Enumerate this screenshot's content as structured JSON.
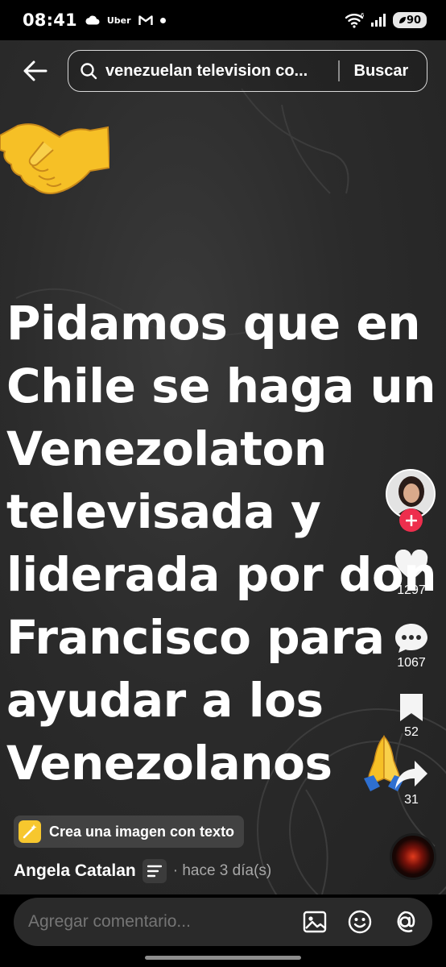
{
  "status_bar": {
    "time": "08:41",
    "uber_label": "Uber",
    "network_label": "6",
    "battery": "90"
  },
  "search": {
    "query": "venezuelan television co...",
    "button_label": "Buscar"
  },
  "post": {
    "caption": "Pidamos que en\nChile se haga un\nVenezolaton\ntelevisada y\nliderada por don\nFrancisco para\nayudar a los\nVenezolanos",
    "likes": "1297",
    "comments": "1067",
    "saves": "52",
    "shares": "31",
    "create_chip_label": "Crea una imagen con texto",
    "author": "Angela Catalan",
    "time_ago": "· hace 3 día(s)"
  },
  "comment_bar": {
    "placeholder": "Agregar comentario..."
  },
  "colors": {
    "follow": "#ee2e4d",
    "chip_icon": "#f7c72e",
    "emoji": "#f6c026"
  },
  "icons": [
    "cloud-icon",
    "gmail-icon",
    "wifi-icon",
    "signal-icon",
    "back-arrow-icon",
    "search-icon",
    "heart-icon",
    "comment-icon",
    "bookmark-icon",
    "share-icon",
    "image-icon",
    "emoji-icon",
    "at-icon",
    "handshake-emoji",
    "pray-emoji"
  ]
}
